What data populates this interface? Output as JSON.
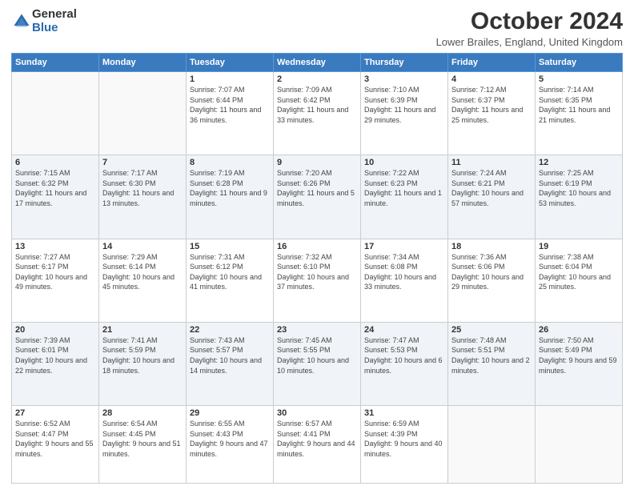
{
  "logo": {
    "general": "General",
    "blue": "Blue"
  },
  "header": {
    "month": "October 2024",
    "location": "Lower Brailes, England, United Kingdom"
  },
  "weekdays": [
    "Sunday",
    "Monday",
    "Tuesday",
    "Wednesday",
    "Thursday",
    "Friday",
    "Saturday"
  ],
  "weeks": [
    [
      {
        "day": "",
        "info": ""
      },
      {
        "day": "",
        "info": ""
      },
      {
        "day": "1",
        "info": "Sunrise: 7:07 AM\nSunset: 6:44 PM\nDaylight: 11 hours and 36 minutes."
      },
      {
        "day": "2",
        "info": "Sunrise: 7:09 AM\nSunset: 6:42 PM\nDaylight: 11 hours and 33 minutes."
      },
      {
        "day": "3",
        "info": "Sunrise: 7:10 AM\nSunset: 6:39 PM\nDaylight: 11 hours and 29 minutes."
      },
      {
        "day": "4",
        "info": "Sunrise: 7:12 AM\nSunset: 6:37 PM\nDaylight: 11 hours and 25 minutes."
      },
      {
        "day": "5",
        "info": "Sunrise: 7:14 AM\nSunset: 6:35 PM\nDaylight: 11 hours and 21 minutes."
      }
    ],
    [
      {
        "day": "6",
        "info": "Sunrise: 7:15 AM\nSunset: 6:32 PM\nDaylight: 11 hours and 17 minutes."
      },
      {
        "day": "7",
        "info": "Sunrise: 7:17 AM\nSunset: 6:30 PM\nDaylight: 11 hours and 13 minutes."
      },
      {
        "day": "8",
        "info": "Sunrise: 7:19 AM\nSunset: 6:28 PM\nDaylight: 11 hours and 9 minutes."
      },
      {
        "day": "9",
        "info": "Sunrise: 7:20 AM\nSunset: 6:26 PM\nDaylight: 11 hours and 5 minutes."
      },
      {
        "day": "10",
        "info": "Sunrise: 7:22 AM\nSunset: 6:23 PM\nDaylight: 11 hours and 1 minute."
      },
      {
        "day": "11",
        "info": "Sunrise: 7:24 AM\nSunset: 6:21 PM\nDaylight: 10 hours and 57 minutes."
      },
      {
        "day": "12",
        "info": "Sunrise: 7:25 AM\nSunset: 6:19 PM\nDaylight: 10 hours and 53 minutes."
      }
    ],
    [
      {
        "day": "13",
        "info": "Sunrise: 7:27 AM\nSunset: 6:17 PM\nDaylight: 10 hours and 49 minutes."
      },
      {
        "day": "14",
        "info": "Sunrise: 7:29 AM\nSunset: 6:14 PM\nDaylight: 10 hours and 45 minutes."
      },
      {
        "day": "15",
        "info": "Sunrise: 7:31 AM\nSunset: 6:12 PM\nDaylight: 10 hours and 41 minutes."
      },
      {
        "day": "16",
        "info": "Sunrise: 7:32 AM\nSunset: 6:10 PM\nDaylight: 10 hours and 37 minutes."
      },
      {
        "day": "17",
        "info": "Sunrise: 7:34 AM\nSunset: 6:08 PM\nDaylight: 10 hours and 33 minutes."
      },
      {
        "day": "18",
        "info": "Sunrise: 7:36 AM\nSunset: 6:06 PM\nDaylight: 10 hours and 29 minutes."
      },
      {
        "day": "19",
        "info": "Sunrise: 7:38 AM\nSunset: 6:04 PM\nDaylight: 10 hours and 25 minutes."
      }
    ],
    [
      {
        "day": "20",
        "info": "Sunrise: 7:39 AM\nSunset: 6:01 PM\nDaylight: 10 hours and 22 minutes."
      },
      {
        "day": "21",
        "info": "Sunrise: 7:41 AM\nSunset: 5:59 PM\nDaylight: 10 hours and 18 minutes."
      },
      {
        "day": "22",
        "info": "Sunrise: 7:43 AM\nSunset: 5:57 PM\nDaylight: 10 hours and 14 minutes."
      },
      {
        "day": "23",
        "info": "Sunrise: 7:45 AM\nSunset: 5:55 PM\nDaylight: 10 hours and 10 minutes."
      },
      {
        "day": "24",
        "info": "Sunrise: 7:47 AM\nSunset: 5:53 PM\nDaylight: 10 hours and 6 minutes."
      },
      {
        "day": "25",
        "info": "Sunrise: 7:48 AM\nSunset: 5:51 PM\nDaylight: 10 hours and 2 minutes."
      },
      {
        "day": "26",
        "info": "Sunrise: 7:50 AM\nSunset: 5:49 PM\nDaylight: 9 hours and 59 minutes."
      }
    ],
    [
      {
        "day": "27",
        "info": "Sunrise: 6:52 AM\nSunset: 4:47 PM\nDaylight: 9 hours and 55 minutes."
      },
      {
        "day": "28",
        "info": "Sunrise: 6:54 AM\nSunset: 4:45 PM\nDaylight: 9 hours and 51 minutes."
      },
      {
        "day": "29",
        "info": "Sunrise: 6:55 AM\nSunset: 4:43 PM\nDaylight: 9 hours and 47 minutes."
      },
      {
        "day": "30",
        "info": "Sunrise: 6:57 AM\nSunset: 4:41 PM\nDaylight: 9 hours and 44 minutes."
      },
      {
        "day": "31",
        "info": "Sunrise: 6:59 AM\nSunset: 4:39 PM\nDaylight: 9 hours and 40 minutes."
      },
      {
        "day": "",
        "info": ""
      },
      {
        "day": "",
        "info": ""
      }
    ]
  ]
}
